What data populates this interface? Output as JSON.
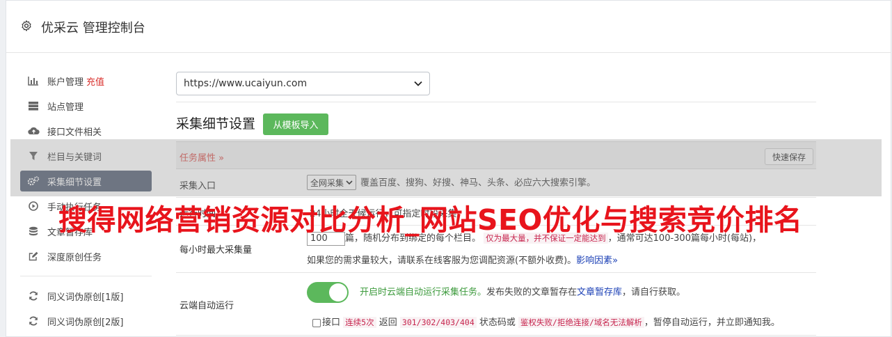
{
  "header": {
    "title": "优采云 管理控制台",
    "icon": "gear-icon"
  },
  "sidebar": {
    "items": [
      {
        "label": "账户管理",
        "extra": "充值",
        "icon": "bar-chart-icon"
      },
      {
        "label": "站点管理",
        "icon": "server-icon"
      },
      {
        "label": "接口文件相关",
        "icon": "cloud-upload-icon"
      },
      {
        "label": "栏目与关键词",
        "icon": "filter-icon"
      },
      {
        "label": "采集细节设置",
        "icon": "cogs-icon",
        "active": true
      },
      {
        "label": "手动执行任务",
        "icon": "play-circle-icon"
      },
      {
        "label": "文章暂存库",
        "icon": "database-icon"
      },
      {
        "label": "深度原创任务",
        "icon": "edit-icon"
      },
      {
        "label": "同义词伪原创[1版]",
        "icon": "refresh-icon"
      },
      {
        "label": "同义词伪原创[2版]",
        "icon": "refresh-icon"
      }
    ]
  },
  "main": {
    "site_select": "https://www.ucaiyun.com",
    "section_title": "采集细节设置",
    "import_button": "从模板导入",
    "task_bar": {
      "label": "任务属性 »",
      "quick_save": "快速保存"
    },
    "collect_entry": {
      "label": "采集入口",
      "select": "全网采集",
      "desc": "覆盖百度、搜狗、好搜、神马、头条、必应六大搜索引擎。"
    },
    "run_time": {
      "label": "运行时间",
      "desc": "24小时全天候运行，可指定时段采集"
    },
    "max_hourly": {
      "label": "每小时最大采集量",
      "value": "100",
      "text1": "篇，随机分布到绑定的每个栏目。",
      "code": "仅为最大量，并不保证一定能达到",
      "text2": "，通常可达100-300篇每小时(每站)，",
      "line2": "如果您的需求量较大，请联系在线客服为您调配资源(不额外收费)。",
      "link": "影响因素»"
    },
    "cloud_auto": {
      "label": "云端自动运行",
      "green_text": "开启时云端自动运行采集任务。",
      "text1": "发布失败的文章暂存在",
      "link": "文章暂存库",
      "text2": "，请自行获取。",
      "chk_label": "接口",
      "code1": "连续5次",
      "text3": "返回",
      "code2": "301/302/403/404",
      "text4": "状态码或",
      "code3": "鉴权失败/拒绝连接/域名无法解析",
      "text5": "，暂停自动运行，并立即通知我。"
    }
  },
  "watermark": "搜得网络营销资源对比分析_网站SEO优化与搜索竞价排名",
  "colors": {
    "accent_green": "#5cb85c",
    "active_nav": "#5a6478",
    "watermark_red": "#e8141c"
  }
}
